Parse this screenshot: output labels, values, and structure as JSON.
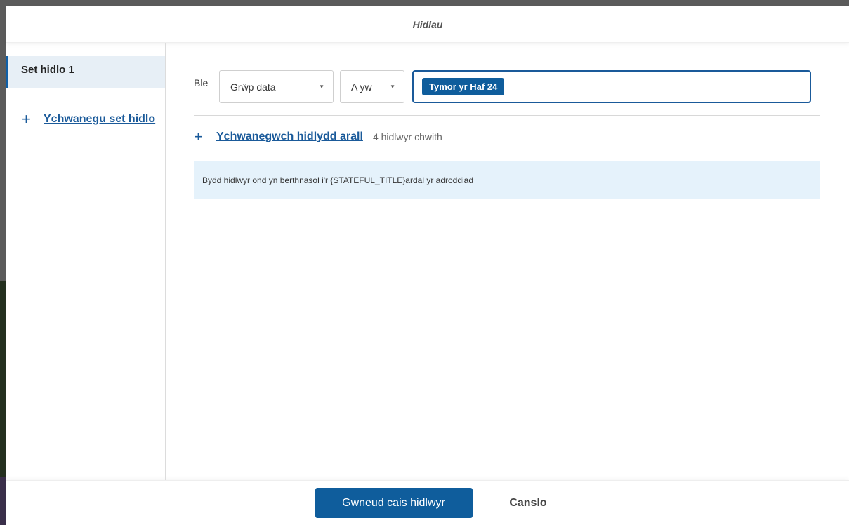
{
  "dialog": {
    "title": "Hidlau"
  },
  "sidebar": {
    "items": [
      {
        "label": "Set hidlo 1",
        "active": true
      }
    ],
    "add_set_label": "Ychwanegu set hidlo"
  },
  "filter": {
    "where_label": "Ble",
    "field": "Grŵp data",
    "operator": "A yw",
    "values": [
      "Tymor yr Haf 24"
    ]
  },
  "add_filter": {
    "label": "Ychwanegwch hidlydd arall",
    "remaining": "4 hidlwyr chwith"
  },
  "info_message": "Bydd hidlwyr ond yn berthnasol i'r {STATEFUL_TITLE}ardal yr adroddiad",
  "footer": {
    "apply_label": "Gwneud cais hidlwyr",
    "cancel_label": "Canslo"
  },
  "colors": {
    "primary": "#0f5d9c",
    "link": "#1a5a9a",
    "info_bg": "#e5f2fb",
    "active_bg": "#e7eff6"
  },
  "icons": {
    "add": "plus-icon",
    "dropdown": "caret-down-icon"
  }
}
